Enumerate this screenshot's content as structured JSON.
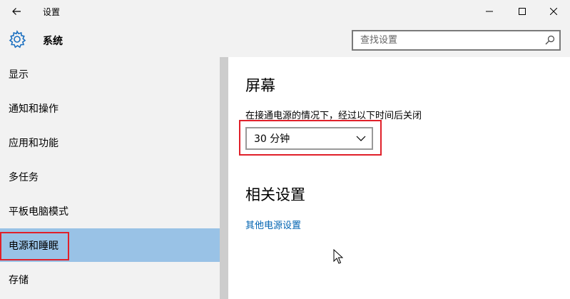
{
  "window": {
    "title": "设置"
  },
  "header": {
    "title": "系统",
    "search_placeholder": "查找设置"
  },
  "sidebar": {
    "items": [
      {
        "label": "显示"
      },
      {
        "label": "通知和操作"
      },
      {
        "label": "应用和功能"
      },
      {
        "label": "多任务"
      },
      {
        "label": "平板电脑模式"
      },
      {
        "label": "电源和睡眠"
      },
      {
        "label": "存储"
      }
    ],
    "selected_index": 5
  },
  "main": {
    "screen_title": "屏幕",
    "screen_desc": "在接通电源的情况下，经过以下时间后关闭",
    "screen_timeout": "30 分钟",
    "related_title": "相关设置",
    "related_link": "其他电源设置"
  },
  "colors": {
    "selected_bg": "#99c2e6",
    "highlight_red": "#e0202a",
    "link": "#0063b1"
  }
}
